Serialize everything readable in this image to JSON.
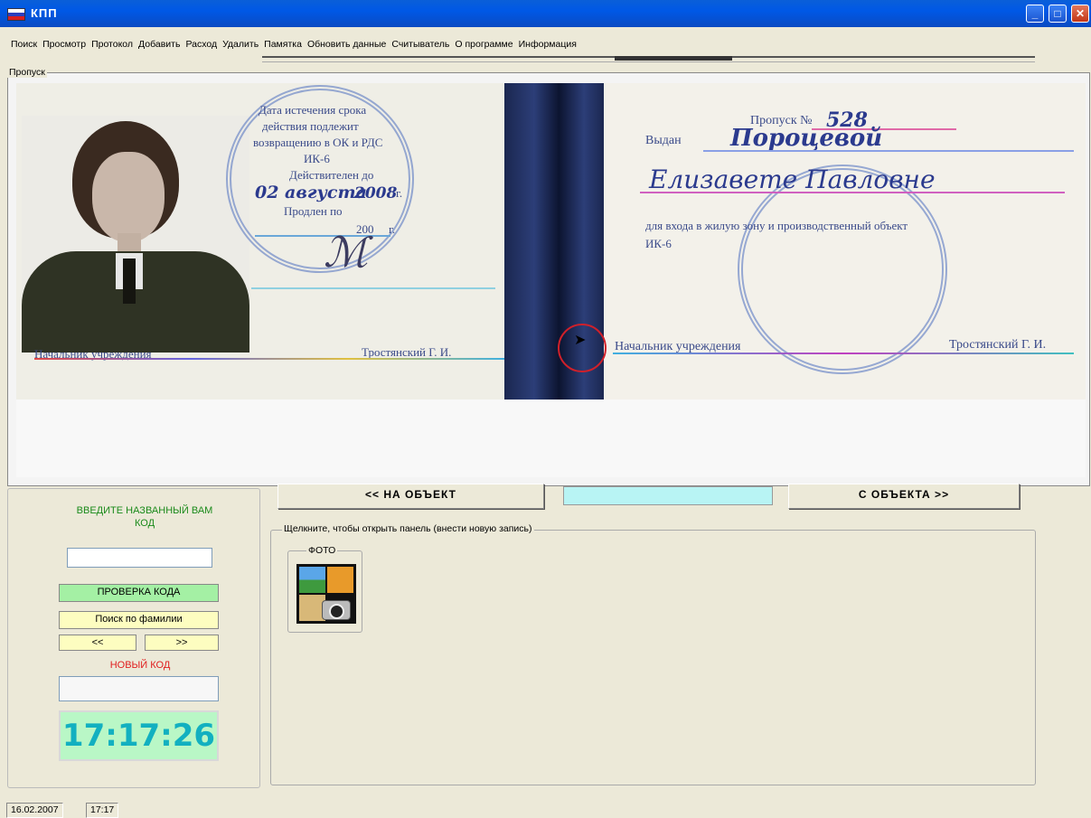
{
  "window": {
    "title": "КПП",
    "minimize_glyph": "_",
    "maximize_glyph": "□",
    "close_glyph": "✕"
  },
  "colors": {
    "titlebar": "#0058e6",
    "clock_bg": "#b9f7c6",
    "clock_text": "#12b0c0",
    "accent_green": "#1a8a1a",
    "accent_red": "#e02020",
    "cyan_box": "#b8f4f4",
    "green_button": "#a4f0a4",
    "yellow_button": "#fdfdc0"
  },
  "menu": [
    "Поиск",
    "Просмотр",
    "Протокол",
    "Добавить",
    "Расход",
    "Удалить",
    "Памятка",
    "Обновить данные",
    "Считыватель",
    "О программе",
    "Информация"
  ],
  "pass_group": {
    "legend": "Пропуск",
    "document": {
      "left_lines": [
        "Дата истечения срока",
        "действия подлежит",
        "возвращению в ОК и РДС",
        "ИК-6",
        "Действителен до",
        "г.",
        "Продлен по",
        "г.",
        "200",
        "Начальник учреждения",
        "Тростянский Г. И."
      ],
      "left_hand_date": "02 августа",
      "left_hand_year": "2008",
      "right_lines": [
        "Пропуск №",
        "Выдан",
        "для входа в жилую зону и производственный объект",
        "ИК-6",
        "Начальник учреждения",
        "Тростянский Г. И."
      ],
      "pass_number": "528",
      "issued_to_surname": "Пороцевой",
      "issued_to_name": "Елизавете Павловне"
    }
  },
  "buttons": {
    "to_object": "<< НА ОБЪЕКТ",
    "from_object": "С ОБЪЕКТА >>",
    "check_code": "ПРОВЕРКА КОДА",
    "search_surname": "Поиск по фамилии",
    "prev": "<<",
    "next": ">>"
  },
  "left_panel": {
    "enter_code_label": "ВВЕДИТЕ НАЗВАННЫЙ ВАМ КОД",
    "new_code_label": "НОВЫЙ КОД",
    "clock": "17:17:26"
  },
  "panel_group": {
    "legend": "Щелкните, чтобы открыть панель (внести новую запись)",
    "foto_legend": "ФОТО"
  },
  "statusbar": {
    "date": "16.02.2007",
    "time": "17:17"
  }
}
